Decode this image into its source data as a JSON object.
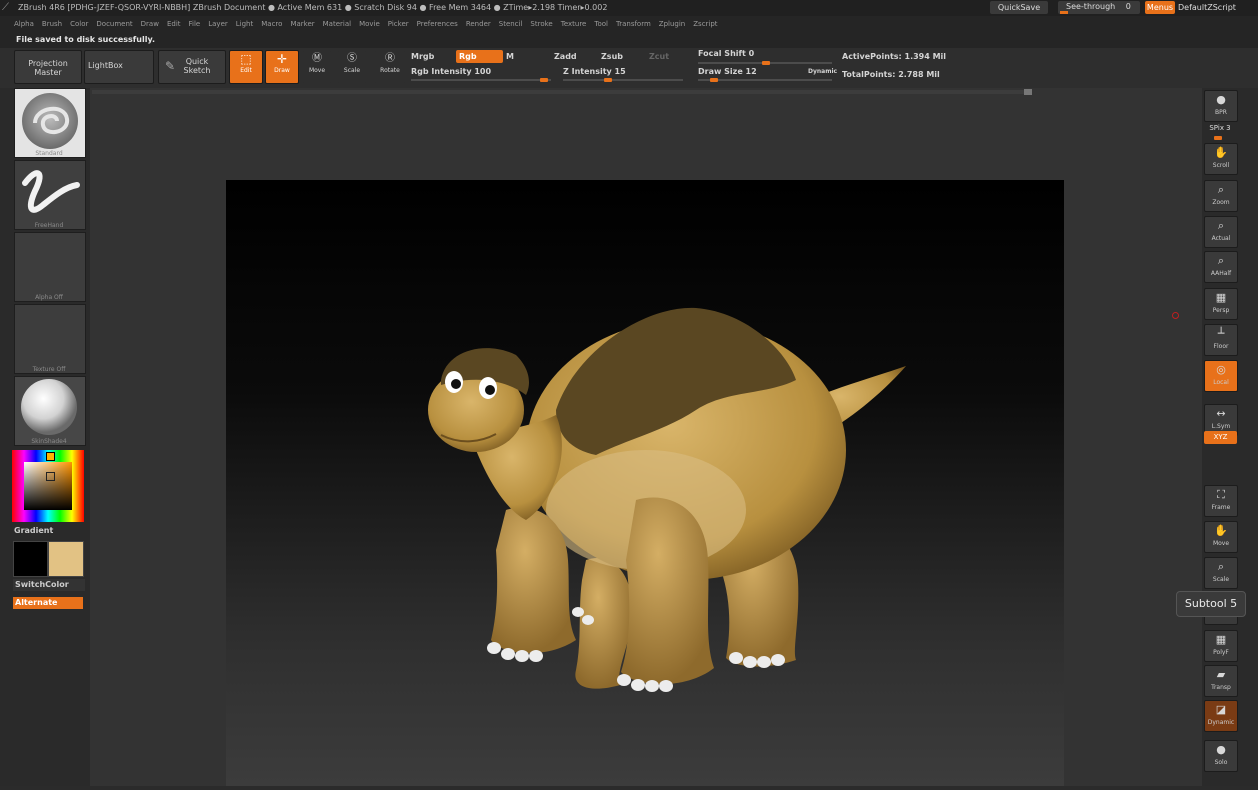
{
  "titlebar": {
    "text": "ZBrush 4R6 [PDHG-JZEF-QSOR-VYRI-NBBH]   ZBrush Document    ● Active Mem 631  ● Scratch Disk 94  ● Free Mem 3464  ● ZTime▸2.198 Timer▸0.002",
    "quicksave": "QuickSave",
    "see_through": "See-through",
    "see_through_value": "0",
    "menus": "Menus",
    "default_zscript": "DefaultZScript"
  },
  "menubar": [
    "Alpha",
    "Brush",
    "Color",
    "Document",
    "Draw",
    "Edit",
    "File",
    "Layer",
    "Light",
    "Macro",
    "Marker",
    "Material",
    "Movie",
    "Picker",
    "Preferences",
    "Render",
    "Stencil",
    "Stroke",
    "Texture",
    "Tool",
    "Transform",
    "Zplugin",
    "Zscript"
  ],
  "status": "File saved to disk successfully.",
  "toolbar": {
    "projection_master": "Projection Master",
    "lightbox": "LightBox",
    "quick_sketch": "Quick Sketch",
    "edit": "Edit",
    "draw": "Draw",
    "move": "Move",
    "scale": "Scale",
    "rotate": "Rotate",
    "mrgb": "Mrgb",
    "rgb": "Rgb",
    "m": "M",
    "rgb_intensity": "Rgb  Intensity 100",
    "zadd": "Zadd",
    "zsub": "Zsub",
    "zcut": "Zcut",
    "z_intensity": "Z  Intensity 15",
    "focal_shift": "Focal  Shift 0",
    "draw_size": "Draw  Size 12",
    "dynamic": "Dynamic",
    "active_points": "ActivePoints: 1.394  Mil",
    "total_points": "TotalPoints: 2.788  Mil"
  },
  "leftpanel": {
    "brush": "Standard",
    "stroke": "FreeHand",
    "alpha": "Alpha  Off",
    "texture": "Texture  Off",
    "material": "SkinShade4",
    "gradient": "Gradient",
    "switch_color": "SwitchColor",
    "alternate": "Alternate"
  },
  "rightshelf": [
    {
      "name": "bpr",
      "label": "BPR"
    },
    {
      "name": "spix",
      "label": "SPix 3"
    },
    {
      "name": "scroll",
      "label": "Scroll"
    },
    {
      "name": "zoom",
      "label": "Zoom"
    },
    {
      "name": "actual",
      "label": "Actual"
    },
    {
      "name": "aahalf",
      "label": "AAHalf"
    },
    {
      "name": "persp",
      "label": "Persp"
    },
    {
      "name": "floor",
      "label": "Floor"
    },
    {
      "name": "local",
      "label": "Local"
    },
    {
      "name": "lsym",
      "label": "L.Sym"
    },
    {
      "name": "xyz",
      "label": "XYZ"
    },
    {
      "name": "frame",
      "label": "Frame"
    },
    {
      "name": "move",
      "label": "Move"
    },
    {
      "name": "scale",
      "label": "Scale"
    },
    {
      "name": "rotate",
      "label": "Rotate"
    },
    {
      "name": "polyf",
      "label": "PolyF"
    },
    {
      "name": "transp",
      "label": "Transp"
    },
    {
      "name": "dynamic",
      "label": "Dynamic"
    },
    {
      "name": "solo",
      "label": "Solo"
    }
  ],
  "tooltip": "Subtool 5",
  "colors": {
    "accent": "#e8711a",
    "main_color": "#e2c284",
    "secondary_color": "#000000"
  }
}
